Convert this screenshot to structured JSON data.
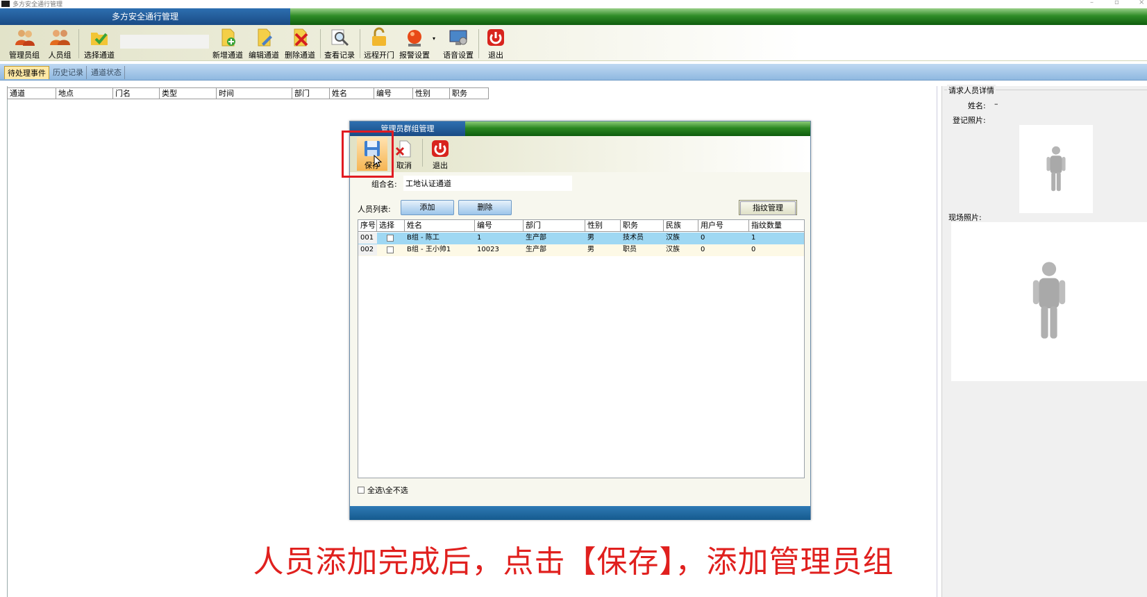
{
  "window": {
    "title": "多方安全通行管理",
    "min_glyph": "–",
    "max_glyph": "▫",
    "close_glyph": "×"
  },
  "caption": {
    "title": "多方安全通行管理"
  },
  "toolbar": {
    "admin_group": "管理员组",
    "person_group": "人员组",
    "select_channel": "选择通道",
    "add_channel": "新增通道",
    "edit_channel": "编辑通道",
    "delete_channel": "删除通道",
    "view_records": "查看记录",
    "remote_open": "远程开门",
    "alarm_settings": "报警设置",
    "dropdown_glyph": "▾",
    "voice_settings": "语音设置",
    "exit": "退出"
  },
  "tabs": [
    "待处理事件",
    "历史记录",
    "通道状态"
  ],
  "event_grid": {
    "columns": [
      "通道",
      "地点",
      "门名",
      "类型",
      "时间",
      "部门",
      "姓名",
      "编号",
      "性别",
      "职务"
    ]
  },
  "detail": {
    "group_title": "请求人员详情",
    "name_label": "姓名:",
    "name_value": "–",
    "reg_photo_label": "登记照片:",
    "live_photo_label": "现场照片:"
  },
  "dialog": {
    "title": "管理员群组管理",
    "save": "保存",
    "cancel": "取消",
    "exit": "退出",
    "group_name_label": "组合名:",
    "group_name_value": "工地认证通道",
    "person_list_label": "人员列表:",
    "add": "添加",
    "delete": "删除",
    "fingerprint": "指纹管理",
    "columns": [
      "序号",
      "选择",
      "姓名",
      "编号",
      "部门",
      "性别",
      "职务",
      "民族",
      "用户号",
      "指纹数量"
    ],
    "rows": [
      {
        "seq": "001",
        "name": "B组 - 陈工",
        "id": "1",
        "dept": "生产部",
        "gender": "男",
        "title": "技术员",
        "ethnic": "汉族",
        "user_no": "0",
        "fp": "1"
      },
      {
        "seq": "002",
        "name": "B组 - 王小帅1",
        "id": "10023",
        "dept": "生产部",
        "gender": "男",
        "title": "职员",
        "ethnic": "汉族",
        "user_no": "0",
        "fp": "0"
      }
    ],
    "select_all": "全选\\全不选"
  },
  "overlay": {
    "subtitle": "人员添加完成后，点击【保存】，添加管理员组"
  },
  "colors": {
    "caption_green": "#2f8c27",
    "caption_blue": "#1a4b85",
    "selected_row": "#9fd8f3",
    "alt_row": "#fdf9e6",
    "highlight": "#e11b22",
    "subtitle": "#e0201e"
  }
}
